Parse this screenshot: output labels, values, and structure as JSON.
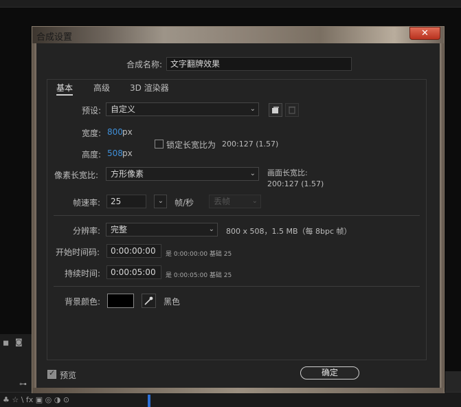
{
  "dialog": {
    "title": "合成设置",
    "close_glyph": "✕",
    "comp_name_label": "合成名称:",
    "comp_name_value": "文字翻牌效果",
    "tabs": [
      {
        "label": "基本",
        "active": true
      },
      {
        "label": "高级",
        "active": false
      },
      {
        "label": "3D 渲染器",
        "active": false
      }
    ],
    "preset": {
      "label": "预设:",
      "value": "自定义"
    },
    "width": {
      "label": "宽度:",
      "value": "800",
      "unit": "px"
    },
    "height": {
      "label": "高度:",
      "value": "508",
      "unit": "px"
    },
    "lock_aspect": {
      "label": "锁定长宽比为",
      "value": "200:127 (1.57)",
      "checked": false
    },
    "pixel_aspect": {
      "label": "像素长宽比:",
      "value": "方形像素"
    },
    "frame_aspect": {
      "label": "画面长宽比:",
      "value": "200:127 (1.57)"
    },
    "frame_rate": {
      "label": "帧速率:",
      "value": "25",
      "unit": "帧/秒",
      "drop_frame": "丢帧"
    },
    "resolution": {
      "label": "分辨率:",
      "value": "完整",
      "info": "800 x 508，1.5 MB（每 8bpc 帧）"
    },
    "start_timecode": {
      "label": "开始时间码:",
      "value": "0:00:00:00",
      "note": "是 0:00:00:00  基础 25"
    },
    "duration": {
      "label": "持续时间:",
      "value": "0:00:05:00",
      "note": "是 0:00:05:00  基础 25"
    },
    "bg_color": {
      "label": "背景颜色:",
      "color": "#000000",
      "name": "黑色"
    },
    "preview": {
      "label": "预览",
      "checked": true
    },
    "ok_label": "确定"
  },
  "colors": {
    "accent_blue": "#3f8fd8",
    "dialog_bg": "#232323",
    "close_red": "#c8412b"
  }
}
